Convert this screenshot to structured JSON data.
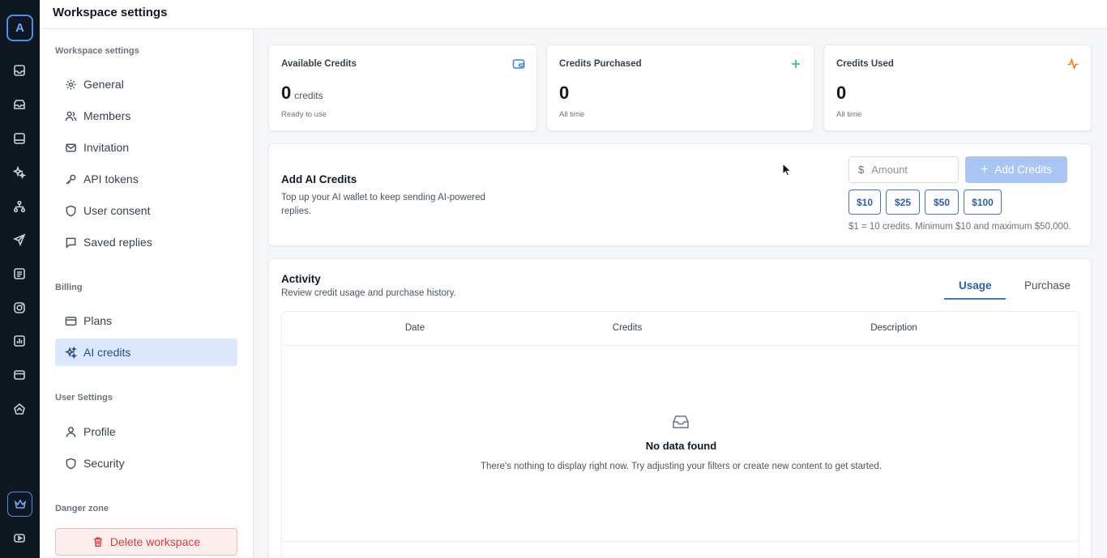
{
  "app": {
    "logo_letter": "A",
    "header_title": "Workspace settings"
  },
  "rail_icons": [
    "inbox-icon",
    "archive-icon",
    "tray-icon",
    "sparkle-icon",
    "hierarchy-icon",
    "send-icon",
    "list-icon",
    "instagram-icon",
    "chart-icon",
    "card-icon",
    "flow-icon",
    "crown-icon",
    "youtube-icon"
  ],
  "sidebar": {
    "sections": {
      "workspace": "Workspace settings",
      "billing": "Billing",
      "user": "User Settings",
      "danger": "Danger zone"
    },
    "items": {
      "general": "General",
      "members": "Members",
      "invitation": "Invitation",
      "api_tokens": "API tokens",
      "user_consent": "User consent",
      "saved_replies": "Saved replies",
      "plans": "Plans",
      "ai_credits": "AI credits",
      "profile": "Profile",
      "security": "Security"
    },
    "active_item": "ai_credits",
    "delete_label": "Delete workspace"
  },
  "stats": [
    {
      "label": "Available Credits",
      "value": "0",
      "unit": "credits",
      "sub": "Ready to use",
      "icon": "wallet-icon",
      "color": "#3b82f6"
    },
    {
      "label": "Credits Purchased",
      "value": "0",
      "unit": "",
      "sub": "All time",
      "icon": "plus-icon",
      "color": "#22c55e"
    },
    {
      "label": "Credits Used",
      "value": "0",
      "unit": "",
      "sub": "All time",
      "icon": "activity-icon",
      "color": "#f97316"
    }
  ],
  "add_credits": {
    "title": "Add AI Credits",
    "description": "Top up your AI wallet to keep sending AI-powered replies.",
    "currency_symbol": "$",
    "amount_placeholder": "Amount",
    "button_label": "Add Credits",
    "presets": [
      "$10",
      "$25",
      "$50",
      "$100"
    ],
    "hint": "$1 = 10 credits. Minimum $10 and maximum $50,000."
  },
  "activity": {
    "title": "Activity",
    "description": "Review credit usage and purchase history.",
    "tabs": [
      "Usage",
      "Purchase"
    ],
    "active_tab": "Usage",
    "columns": [
      "Date",
      "Credits",
      "Description"
    ],
    "empty_title": "No data found",
    "empty_description": "There's nothing to display right now. Try adjusting your filters or create new content to get started."
  },
  "colors": {
    "accent": "#3f78c9",
    "rail_bg": "#0f1720",
    "active_bg": "#dbe8fb",
    "danger": "#dc3b3b"
  }
}
